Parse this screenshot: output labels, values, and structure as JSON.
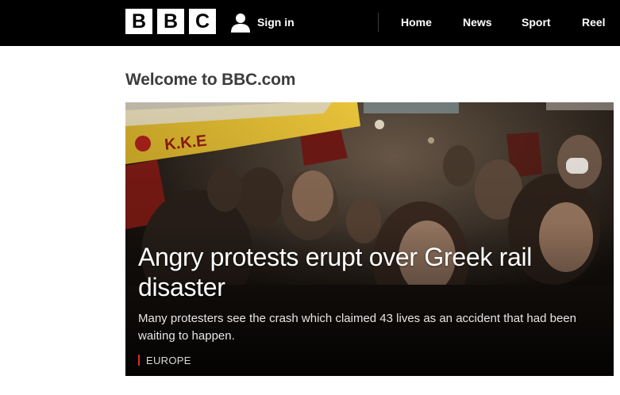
{
  "header": {
    "logo_letters": [
      "B",
      "B",
      "C"
    ],
    "signin_label": "Sign in",
    "signin_icon": "user-icon",
    "nav": [
      {
        "label": "Home"
      },
      {
        "label": "News"
      },
      {
        "label": "Sport"
      },
      {
        "label": "Reel"
      }
    ],
    "background_color": "#000000"
  },
  "main": {
    "welcome_title": "Welcome to BBC.com",
    "hero": {
      "headline": "Angry protests erupt over Greek rail disaster",
      "summary": "Many protesters see the crash which claimed 43 lives as an accident that had been waiting to happen.",
      "tag": "EUROPE",
      "tag_color": "#d62d20",
      "banner_text": "K.K.E"
    }
  }
}
